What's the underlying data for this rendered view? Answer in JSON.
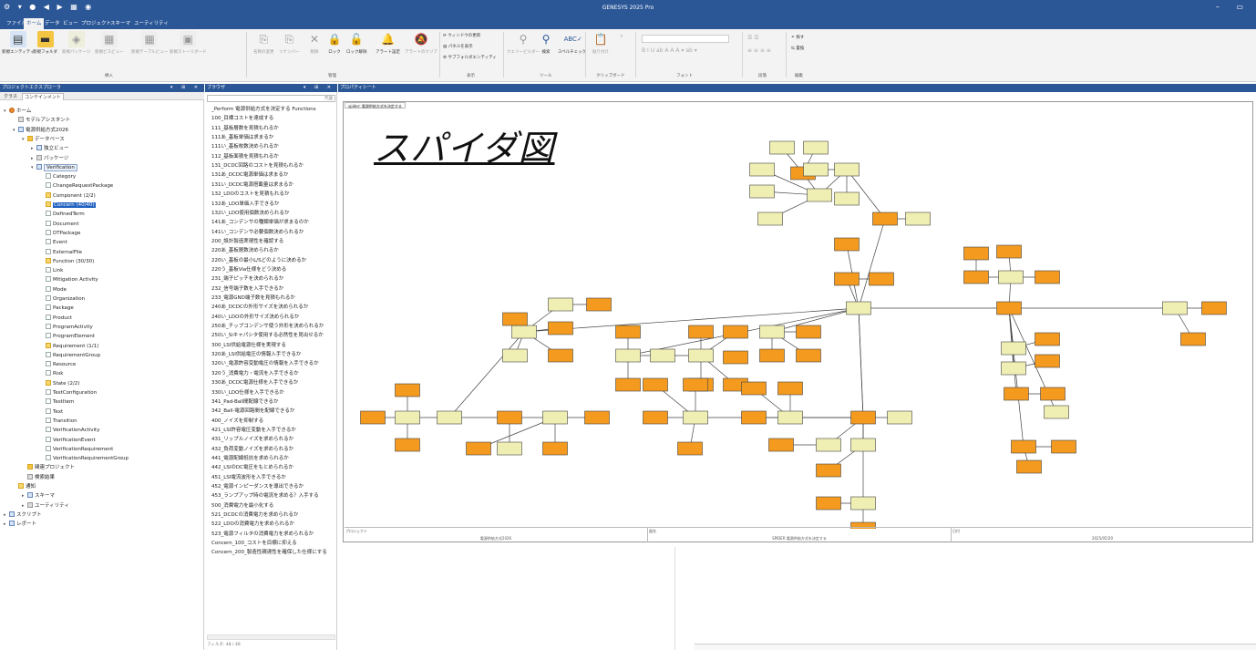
{
  "window": {
    "title": "GENESYS 2025 Pro"
  },
  "ribbon_tabs": [
    "ファイル",
    "ホーム",
    "データ",
    "ビュー",
    "プロジェクト",
    "スキーマ",
    "ユーティリティ"
  ],
  "ribbon": {
    "insert": [
      "新規エンティティ",
      "新規フォルダ",
      "新規パッケージ",
      "新規ビスビュー",
      "新規テーブルビュー",
      "新規ストーリボード"
    ],
    "manage": [
      "名称の変更",
      "リナンバー",
      "削除",
      "ロック",
      "ロック解除",
      "アラート設定",
      "アラートのクリア"
    ],
    "view_small": [
      "ウィンドウの更新",
      "パネルを表示",
      "サブフォルダエンティティ"
    ],
    "tools": [
      "クエリービルダー",
      "検索",
      "スペルチェック"
    ],
    "clipboard": [
      "貼り付け"
    ],
    "edit": [
      "探す",
      "置換"
    ],
    "groups": [
      "挿入",
      "管理",
      "表示",
      "ツール",
      "クリップボード",
      "フォント",
      "段落",
      "編集"
    ]
  },
  "explorer": {
    "title": "プロジェクトエクスプローラ",
    "tabs": [
      "クラス",
      "コンテインメント"
    ],
    "tree": [
      {
        "label": "ホーム",
        "icon": "home"
      },
      {
        "label": "モデルアシスタント",
        "icon": "grey"
      },
      {
        "label": "電源供給方式2026",
        "icon": "blue"
      },
      {
        "label": "データベース",
        "icon": "fold"
      },
      {
        "label": "独立ビュー",
        "icon": "blue"
      },
      {
        "label": "パッケージ",
        "icon": "grey"
      },
      {
        "label": "Verification",
        "icon": "blue"
      },
      {
        "label": "Category",
        "icon": "doc"
      },
      {
        "label": "ChangeRequestPackage",
        "icon": "doc"
      },
      {
        "label": "Component  (2/2)",
        "icon": "yel"
      },
      {
        "label": "Concern  (40/40)",
        "icon": "yel"
      },
      {
        "label": "DefinedTerm",
        "icon": "doc"
      },
      {
        "label": "Document",
        "icon": "doc"
      },
      {
        "label": "DTPackage",
        "icon": "doc"
      },
      {
        "label": "Event",
        "icon": "doc"
      },
      {
        "label": "ExternalFile",
        "icon": "doc"
      },
      {
        "label": "Function  (30/30)",
        "icon": "yel"
      },
      {
        "label": "Link",
        "icon": "doc"
      },
      {
        "label": "Mitigation Activity",
        "icon": "doc"
      },
      {
        "label": "Mode",
        "icon": "doc"
      },
      {
        "label": "Organization",
        "icon": "doc"
      },
      {
        "label": "Package",
        "icon": "doc"
      },
      {
        "label": "Product",
        "icon": "doc"
      },
      {
        "label": "ProgramActivity",
        "icon": "doc"
      },
      {
        "label": "ProgramElement",
        "icon": "doc"
      },
      {
        "label": "Requirement  (1/1)",
        "icon": "yel"
      },
      {
        "label": "RequirementGroup",
        "icon": "doc"
      },
      {
        "label": "Resource",
        "icon": "doc"
      },
      {
        "label": "Risk",
        "icon": "doc"
      },
      {
        "label": "State  (2/2)",
        "icon": "yel"
      },
      {
        "label": "TestConfiguration",
        "icon": "doc"
      },
      {
        "label": "TestItem",
        "icon": "doc"
      },
      {
        "label": "Text",
        "icon": "doc"
      },
      {
        "label": "Transition",
        "icon": "doc"
      },
      {
        "label": "VerificationActivity",
        "icon": "doc"
      },
      {
        "label": "VerificationEvent",
        "icon": "doc"
      },
      {
        "label": "VerificationRequirement",
        "icon": "doc"
      },
      {
        "label": "VerificationRequirementGroup",
        "icon": "doc"
      },
      {
        "label": "関連プロジェクト",
        "icon": "fold"
      },
      {
        "label": "検索結果",
        "icon": "grey"
      },
      {
        "label": "通知",
        "icon": "yel"
      },
      {
        "label": "スキーマ",
        "icon": "blue"
      },
      {
        "label": "ユーティリティ",
        "icon": "grey"
      },
      {
        "label": "スクリプト",
        "icon": "blue"
      },
      {
        "label": "レポート",
        "icon": "blue"
      }
    ]
  },
  "browser": {
    "title": "ブラウザ",
    "search_button": "代送",
    "items": [
      "_Perform 電源供給方式を決定する Functions",
      "100_目標コストを達成する",
      "111_基板層数を見積もれるか",
      "111あ_基板単価は求まるか",
      "111い_基板枚数決められるか",
      "112_基板面積を見積もれるか",
      "131_DCDC回路のコストを見積もれるか",
      "131あ_DCDC電源単価は求まるか",
      "131い_DCDC電源搭載量は求まるか",
      "132_LDOのコストを見積もれるか",
      "132あ_LDO単価入手できるか",
      "132い_LDO使用個数決められるか",
      "141あ_コンデンサの種類単価が求まるのか",
      "141い_コンデンサ必要個数決められるか",
      "200_設計製造実現性を確認する",
      "220あ_基板層数決められるか",
      "220い_基板の最小L/Sどのように決めるか",
      "220う_基板Via仕様をどう決める",
      "231_端子ピッチを決められるか",
      "232_信号端子数を入手できるか",
      "233_電源GND端子数を見積もれるか",
      "240あ_DCDCの外形サイズを決められるか",
      "240い_LDOの外形サイズ決められるか",
      "250あ_チップコンデンサ使う外形を決められるか",
      "250い_Siキャパシタ使用する必然性を見出せるか",
      "300_LSI供給電源仕様を実現する",
      "320あ_LSI供給電圧の情報入手できるか",
      "320い_電源許容変動電圧の情報を入手できるか",
      "320う_消費電力・電流を入手できるか",
      "330あ_DCDC電源仕様を入手できるか",
      "330い_LDO仕様を入手できるか",
      "341_Pad-Ball間配線できるか",
      "342_Ball-電源回路間を配線できるか",
      "400_ノイズを抑制する",
      "421_LSI許容電圧変動を入手できるか",
      "431_リップルノイズを求められるか",
      "432_負荷変動ノイズを求められるか",
      "441_電源配線抵抗を求められるか",
      "442_LSIのDC電圧をもとめられるか",
      "451_LSI電流波形を入手できるか",
      "452_電源インピーダンスを導出できるか",
      "453_ランプアップ時の電流を求める？入手する",
      "500_消費電力を最小化する",
      "521_DCDCの消費電力を求められるか",
      "522_LDOの消費電力を求められるか",
      "523_電源フィルタの消費電力を求められるか",
      "Concern_100_コストを目標に抑える",
      "Concern_200_製造性親達性を確保した仕様にする"
    ],
    "status": "フィルタ: 48 / 48"
  },
  "properties": {
    "title": "プロパティシート",
    "diagram_tab": "spider: 電源供給方式を決定する",
    "diagram_title": "スパイダ図",
    "footer_labels": [
      "プロジェクト",
      "図名",
      "日付"
    ],
    "footer_values": [
      "電源供給方式2026",
      "SPIDER 電源供給方式を決定する",
      "2025/05/20"
    ]
  },
  "colors": {
    "accent": "#2b5797",
    "node_orange": "#f39a1f",
    "node_yellow": "#efefb4"
  }
}
